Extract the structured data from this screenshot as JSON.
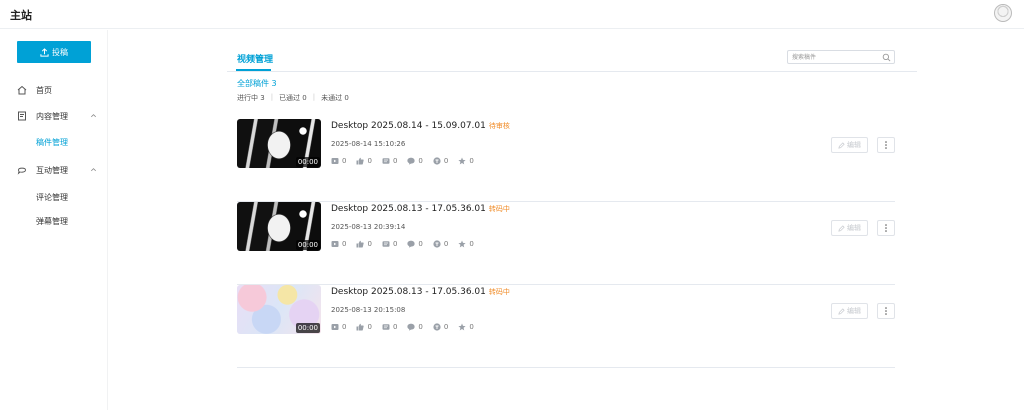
{
  "app": {
    "title": "主站"
  },
  "sidebar": {
    "upload_label": "投稿",
    "items": [
      {
        "label": "首页",
        "icon": "home-icon"
      },
      {
        "label": "内容管理",
        "icon": "content-icon",
        "expanded": true,
        "children": [
          {
            "label": "稿件管理",
            "active": true
          }
        ]
      },
      {
        "label": "互动管理",
        "icon": "chat-icon",
        "expanded": true,
        "children": [
          {
            "label": "评论管理"
          },
          {
            "label": "弹幕管理"
          }
        ]
      }
    ]
  },
  "main": {
    "tab_label": "视频管理",
    "search_placeholder": "搜索稿件",
    "filter_all": "全部稿件 3",
    "filters": [
      "进行中 3",
      "已通过 0",
      "未通过 0"
    ],
    "edit_label": "编辑",
    "videos": [
      {
        "title": "Desktop 2025.08.14 - 15.09.07.01",
        "status": "待审核",
        "date": "2025-08-14 15:10:26",
        "duration": "00:00",
        "thumb_style": "dark",
        "stats": {
          "plays": "0",
          "likes": "0",
          "comments": "0",
          "danmaku": "0",
          "coins": "0",
          "favorites": "0"
        }
      },
      {
        "title": "Desktop 2025.08.13 - 17.05.36.01",
        "status": "转码中",
        "date": "2025-08-13 20:39:14",
        "duration": "00:00",
        "thumb_style": "dark",
        "stats": {
          "plays": "0",
          "likes": "0",
          "comments": "0",
          "danmaku": "0",
          "coins": "0",
          "favorites": "0"
        }
      },
      {
        "title": "Desktop 2025.08.13 - 17.05.36.01",
        "status": "转码中",
        "date": "2025-08-13 20:15:08",
        "duration": "00:00",
        "thumb_style": "pastel",
        "stats": {
          "plays": "0",
          "likes": "0",
          "comments": "0",
          "danmaku": "0",
          "coins": "0",
          "favorites": "0"
        }
      }
    ]
  },
  "colors": {
    "accent": "#00a1d6",
    "status": "#f08a24"
  }
}
